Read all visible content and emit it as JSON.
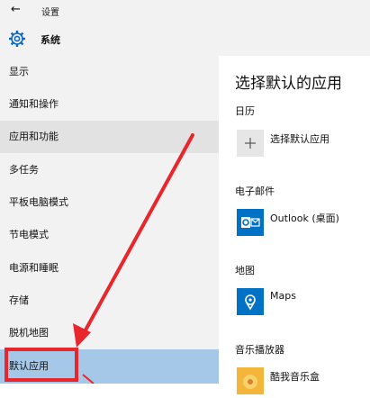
{
  "window": {
    "title": "设置"
  },
  "header": {
    "title": "系统"
  },
  "sidebar": {
    "items": [
      {
        "label": "显示"
      },
      {
        "label": "通知和操作"
      },
      {
        "label": "应用和功能"
      },
      {
        "label": "多任务"
      },
      {
        "label": "平板电脑模式"
      },
      {
        "label": "节电模式"
      },
      {
        "label": "电源和睡眠"
      },
      {
        "label": "存储"
      },
      {
        "label": "脱机地图"
      },
      {
        "label": "默认应用"
      }
    ],
    "selected": "默认应用"
  },
  "main": {
    "title": "选择默认的应用",
    "sections": [
      {
        "label": "日历",
        "app": "选择默认应用",
        "icon": "plus-icon"
      },
      {
        "label": "电子邮件",
        "app": "Outlook (桌面)",
        "icon": "outlook-icon"
      },
      {
        "label": "地图",
        "app": "Maps",
        "icon": "maps-icon"
      },
      {
        "label": "音乐播放器",
        "app": "酷我音乐盒",
        "icon": "music-app-icon"
      }
    ]
  },
  "colors": {
    "accent": "#0072c6",
    "selected_bg": "#a6c8e8",
    "annotation": "#e8262b"
  }
}
